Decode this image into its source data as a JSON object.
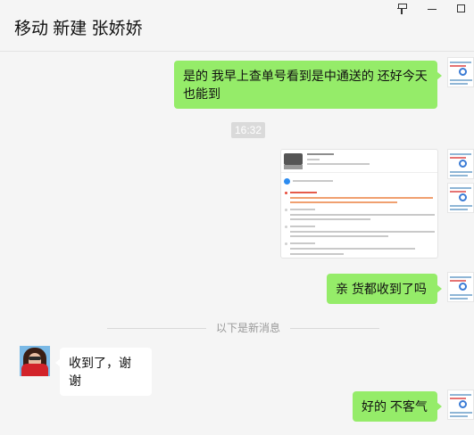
{
  "window": {
    "title": "移动 新建 张娇娇",
    "pin_icon": "pin-icon",
    "minimize_icon": "minimize-icon",
    "maximize_icon": "maximize-icon"
  },
  "messages": {
    "m1": "是的 我早上查单号看到是中通送的 还好今天也能到",
    "time": "16:32",
    "m2": "亲 货都收到了吗",
    "divider": "以下是新消息",
    "m3": "收到了，谢谢",
    "m4": "好的 不客气"
  },
  "colors": {
    "my_bubble": "#95ec69",
    "other_bubble": "#ffffff",
    "background": "#f5f5f5"
  }
}
